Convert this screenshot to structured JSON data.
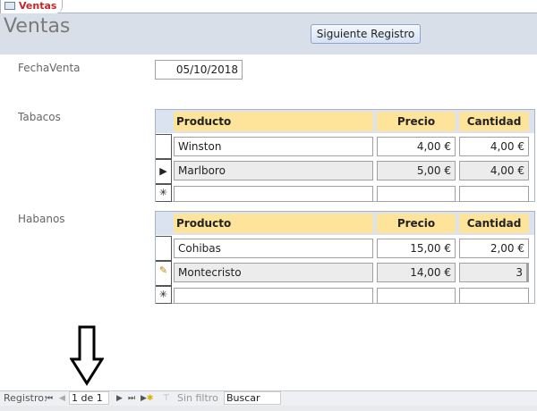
{
  "tab": {
    "label": "Ventas"
  },
  "form": {
    "title": "Ventas",
    "next_button": "Siguiente Registro",
    "fecha_label": "FechaVenta",
    "fecha_value": "05/10/2018"
  },
  "tabacos": {
    "label": "Tabacos",
    "headers": [
      "Producto",
      "Precio",
      "Cantidad"
    ],
    "rows": [
      {
        "producto": "Winston",
        "precio": "4,00 €",
        "cantidad": "4,00 €"
      },
      {
        "producto": "Marlboro",
        "precio": "5,00 €",
        "cantidad": "4,00 €"
      }
    ]
  },
  "habanos": {
    "label": "Habanos",
    "headers": [
      "Producto",
      "Precio",
      "Cantidad"
    ],
    "rows": [
      {
        "producto": "Cohibas",
        "precio": "15,00 €",
        "cantidad": "2,00 €"
      },
      {
        "producto": "Montecristo",
        "precio": "14,00 €",
        "cantidad": "3"
      }
    ]
  },
  "nav": {
    "label": "Registro:",
    "record": "1 de 1",
    "filter": "Sin filtro",
    "search": "Buscar"
  }
}
